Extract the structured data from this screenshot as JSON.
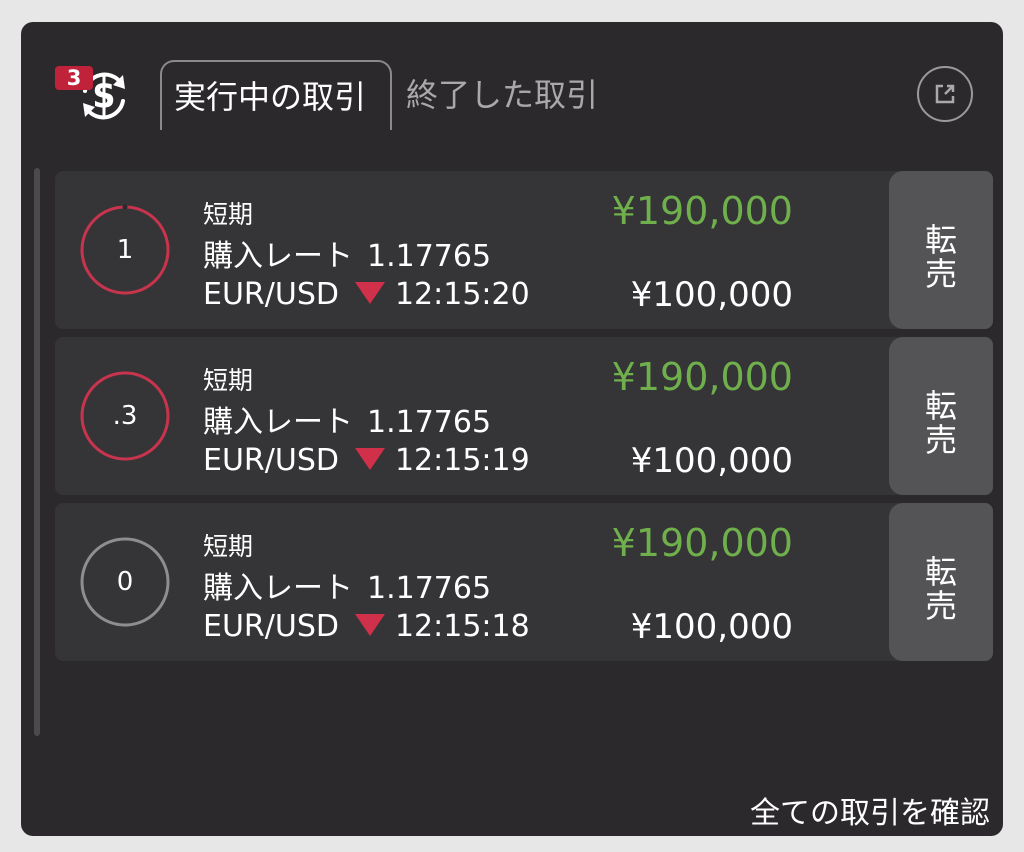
{
  "header": {
    "badge_count": "3",
    "icon": "dollar-cycle-icon",
    "tabs": [
      {
        "label": "実行中の取引",
        "active": true
      },
      {
        "label": "終了した取引",
        "active": false
      }
    ],
    "external_icon": "external-link-icon"
  },
  "colors": {
    "panel_bg": "#2b292c",
    "row_bg": "#353436",
    "profit_green": "#6fb04d",
    "down_red": "#d1304a",
    "badge_red": "#c0223a"
  },
  "trades": [
    {
      "countdown": "1",
      "ring_color": "#c8344e",
      "term": "短期",
      "rate_label": "購入レート",
      "rate_value": "1.17765",
      "pair": "EUR/USD",
      "direction": "down",
      "time": "12:15:20",
      "payout": "¥190,000",
      "amount": "¥100,000",
      "resell_label_1": "転",
      "resell_label_2": "売"
    },
    {
      "countdown": ".3",
      "ring_color": "#c8344e",
      "term": "短期",
      "rate_label": "購入レート",
      "rate_value": "1.17765",
      "pair": "EUR/USD",
      "direction": "down",
      "time": "12:15:19",
      "payout": "¥190,000",
      "amount": "¥100,000",
      "resell_label_1": "転",
      "resell_label_2": "売"
    },
    {
      "countdown": "0",
      "ring_color": "#8e8e91",
      "term": "短期",
      "rate_label": "購入レート",
      "rate_value": "1.17765",
      "pair": "EUR/USD",
      "direction": "down",
      "time": "12:15:18",
      "payout": "¥190,000",
      "amount": "¥100,000",
      "resell_label_1": "転",
      "resell_label_2": "売"
    }
  ],
  "footer": {
    "view_all_label": "全ての取引を確認"
  }
}
